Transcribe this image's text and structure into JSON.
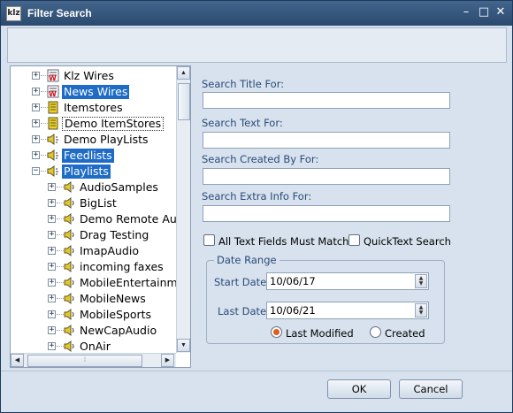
{
  "window": {
    "title": "Filter Search",
    "app_icon_text": "klz",
    "controls": {
      "minimize": "–",
      "maximize": "□",
      "close": "✕"
    }
  },
  "tree": {
    "items": [
      {
        "label": "Klz Wires",
        "level": 0,
        "icon": "wires-icon",
        "selected": false
      },
      {
        "label": "News Wires",
        "level": 0,
        "icon": "wires-icon",
        "selected": true
      },
      {
        "label": "Itemstores",
        "level": 0,
        "icon": "itemstore-icon",
        "selected": false
      },
      {
        "label": "Demo ItemStores",
        "level": 0,
        "icon": "itemstore-icon",
        "selected": false,
        "focused": true
      },
      {
        "label": "Demo PlayLists",
        "level": 0,
        "icon": "playlist-icon",
        "selected": false
      },
      {
        "label": "Feedlists",
        "level": 0,
        "icon": "playlist-icon",
        "selected": true
      },
      {
        "label": "Playlists",
        "level": 0,
        "icon": "playlist-icon",
        "selected": true,
        "expanded": true
      },
      {
        "label": "AudioSamples",
        "level": 1,
        "icon": "speaker-icon",
        "selected": false
      },
      {
        "label": "BigList",
        "level": 1,
        "icon": "speaker-icon",
        "selected": false
      },
      {
        "label": "Demo Remote Aud",
        "level": 1,
        "icon": "speaker-icon",
        "selected": false
      },
      {
        "label": "Drag Testing",
        "level": 1,
        "icon": "speaker-icon",
        "selected": false
      },
      {
        "label": "ImapAudio",
        "level": 1,
        "icon": "speaker-icon",
        "selected": false
      },
      {
        "label": "incoming faxes",
        "level": 1,
        "icon": "speaker-icon",
        "selected": false
      },
      {
        "label": "MobileEntertainme",
        "level": 1,
        "icon": "speaker-icon",
        "selected": false
      },
      {
        "label": "MobileNews",
        "level": 1,
        "icon": "speaker-icon",
        "selected": false
      },
      {
        "label": "MobileSports",
        "level": 1,
        "icon": "speaker-icon",
        "selected": false
      },
      {
        "label": "NewCapAudio",
        "level": 1,
        "icon": "speaker-icon",
        "selected": false
      },
      {
        "label": "OnAir",
        "level": 1,
        "icon": "speaker-icon",
        "selected": false
      }
    ]
  },
  "form": {
    "title_label": "Search Title For:",
    "title_value": "",
    "text_label": "Search Text For:",
    "text_value": "",
    "created_by_label": "Search Created By For:",
    "created_by_value": "",
    "extra_label": "Search Extra Info For:",
    "extra_value": "",
    "all_fields_label": "All Text Fields Must Match",
    "all_fields_checked": false,
    "quicktext_label": "QuickText Search",
    "quicktext_checked": false
  },
  "date_range": {
    "group_label": "Date Range",
    "start_label": "Start Date:",
    "start_value": "10/06/17",
    "last_label": "Last Date:",
    "last_value": "10/06/21",
    "radio_modified": "Last Modified",
    "radio_created": "Created",
    "selected": "Last Modified"
  },
  "buttons": {
    "ok": "OK",
    "cancel": "Cancel"
  },
  "colors": {
    "selection": "#1e6cc7",
    "title_bar": "#2a4a6f",
    "accent_radio": "#e25a1c",
    "label_blue": "#2b4a78"
  }
}
